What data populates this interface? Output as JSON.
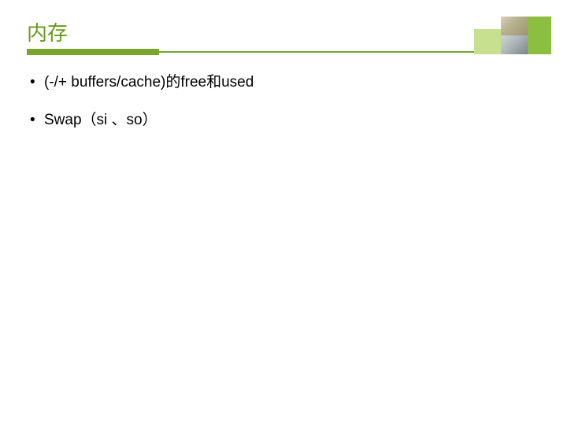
{
  "title": "内存",
  "bullets": [
    "(-/+ buffers/cache)的free和used",
    "Swap（si 、so）"
  ],
  "colors": {
    "accent": "#7aa52a",
    "title": "#6a9a1f",
    "deco_dark": "#8cbf3f",
    "deco_light": "#c7e08f"
  }
}
